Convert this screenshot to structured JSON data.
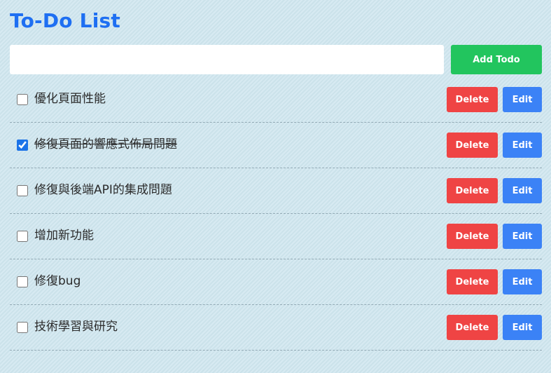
{
  "header": {
    "title": "To-Do List"
  },
  "form": {
    "input_value": "",
    "input_placeholder": "",
    "add_label": "Add Todo"
  },
  "todos": [
    {
      "text": "優化頁面性能",
      "completed": false,
      "delete_label": "Delete",
      "edit_label": "Edit"
    },
    {
      "text": "修復頁面的響應式佈局問題",
      "completed": true,
      "delete_label": "Delete",
      "edit_label": "Edit"
    },
    {
      "text": "修復與後端API的集成問題",
      "completed": false,
      "delete_label": "Delete",
      "edit_label": "Edit"
    },
    {
      "text": "增加新功能",
      "completed": false,
      "delete_label": "Delete",
      "edit_label": "Edit"
    },
    {
      "text": "修復bug",
      "completed": false,
      "delete_label": "Delete",
      "edit_label": "Edit"
    },
    {
      "text": "技術學習與研究",
      "completed": false,
      "delete_label": "Delete",
      "edit_label": "Edit"
    }
  ],
  "colors": {
    "title": "#1e6ff2",
    "add_button": "#22c55e",
    "delete_button": "#ef4444",
    "edit_button": "#3b82f6",
    "background": "#cfe6ef"
  }
}
